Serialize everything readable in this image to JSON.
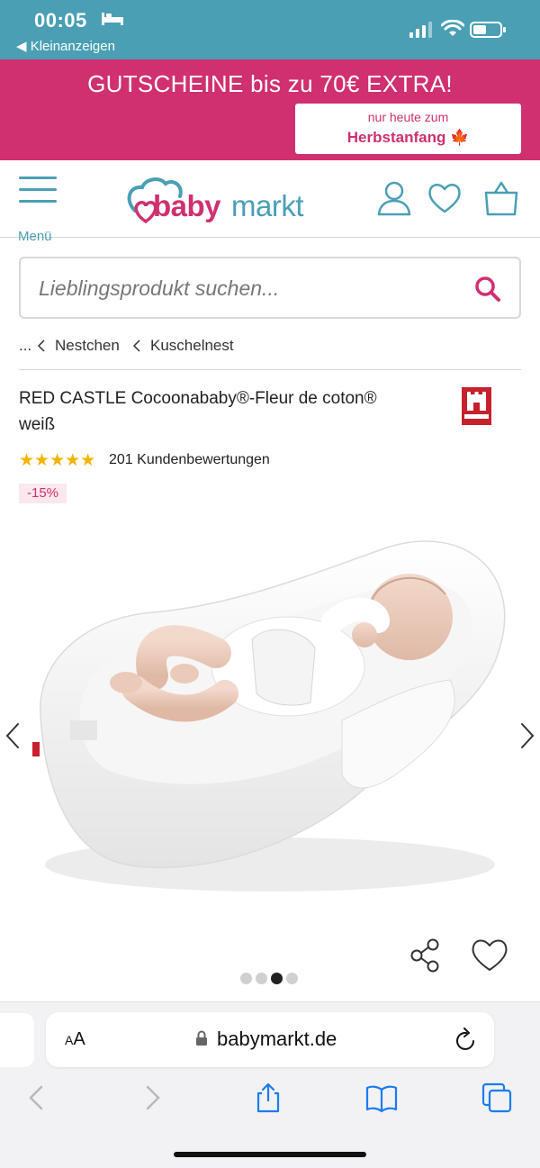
{
  "status_bar": {
    "time": "00:05",
    "back_label": "◀ Kleinanzeigen"
  },
  "promo": {
    "headline": "GUTSCHEINE bis zu 70€ EXTRA!",
    "box_line1": "nur heute zum",
    "box_line2": "Herbstanfang 🍁"
  },
  "header": {
    "menu_label": "Menü",
    "logo_part1": "baby",
    "logo_part2": "markt"
  },
  "search": {
    "placeholder": "Lieblingsprodukt suchen..."
  },
  "breadcrumb": {
    "ellipsis": "...",
    "items": [
      "Nestchen",
      "Kuschelnest"
    ]
  },
  "product": {
    "title": "RED CASTLE Cocoonababy®-Fleur de coton® weiß",
    "stars": "★★★★★",
    "rating_value": 5,
    "review_count": "201 Kundenbewertungen",
    "discount": "-15%",
    "brand": "RED CASTLE",
    "image_count": 4,
    "active_image": 3
  },
  "browser": {
    "aa_label": "AA",
    "url": "babymarkt.de"
  },
  "colors": {
    "brand_pink": "#d0306f",
    "brand_teal": "#4a9fb5",
    "star": "#f2b400"
  }
}
